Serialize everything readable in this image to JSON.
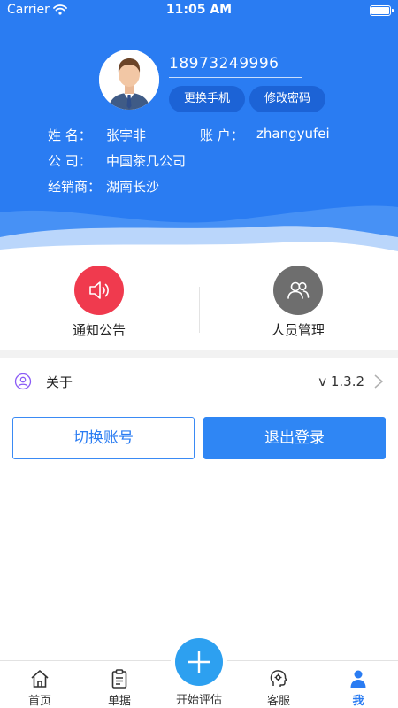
{
  "status_bar": {
    "carrier": "Carrier",
    "time": "11:05 AM"
  },
  "profile": {
    "phone": "18973249996",
    "change_phone_label": "更换手机",
    "change_password_label": "修改密码",
    "name_label": "姓  名：",
    "name_value": "张宇非",
    "account_label": "账  户：",
    "account_value": "zhangyufei",
    "company_label": "公  司：",
    "company_value": "中国茶几公司",
    "dealer_label": "经销商：",
    "dealer_value": "湖南长沙"
  },
  "quick_actions": [
    {
      "label": "通知公告",
      "icon": "speaker-icon",
      "color": "#f03a4e"
    },
    {
      "label": "人员管理",
      "icon": "users-icon",
      "color": "#6e6e6e"
    }
  ],
  "about": {
    "label": "关于",
    "version": "v 1.3.2"
  },
  "buttons": {
    "switch_account": "切换账号",
    "logout": "退出登录"
  },
  "tabbar": {
    "items": [
      {
        "label": "首页",
        "icon": "home-icon"
      },
      {
        "label": "单据",
        "icon": "clipboard-icon"
      },
      {
        "label": "开始评估",
        "icon": "plus-icon"
      },
      {
        "label": "客服",
        "icon": "customer-service-icon"
      },
      {
        "label": "我",
        "icon": "person-icon"
      }
    ],
    "active_index": 4
  },
  "colors": {
    "primary": "#2a7cf2",
    "fab": "#2da0f0",
    "notice": "#f03a4e",
    "staff": "#6e6e6e"
  }
}
